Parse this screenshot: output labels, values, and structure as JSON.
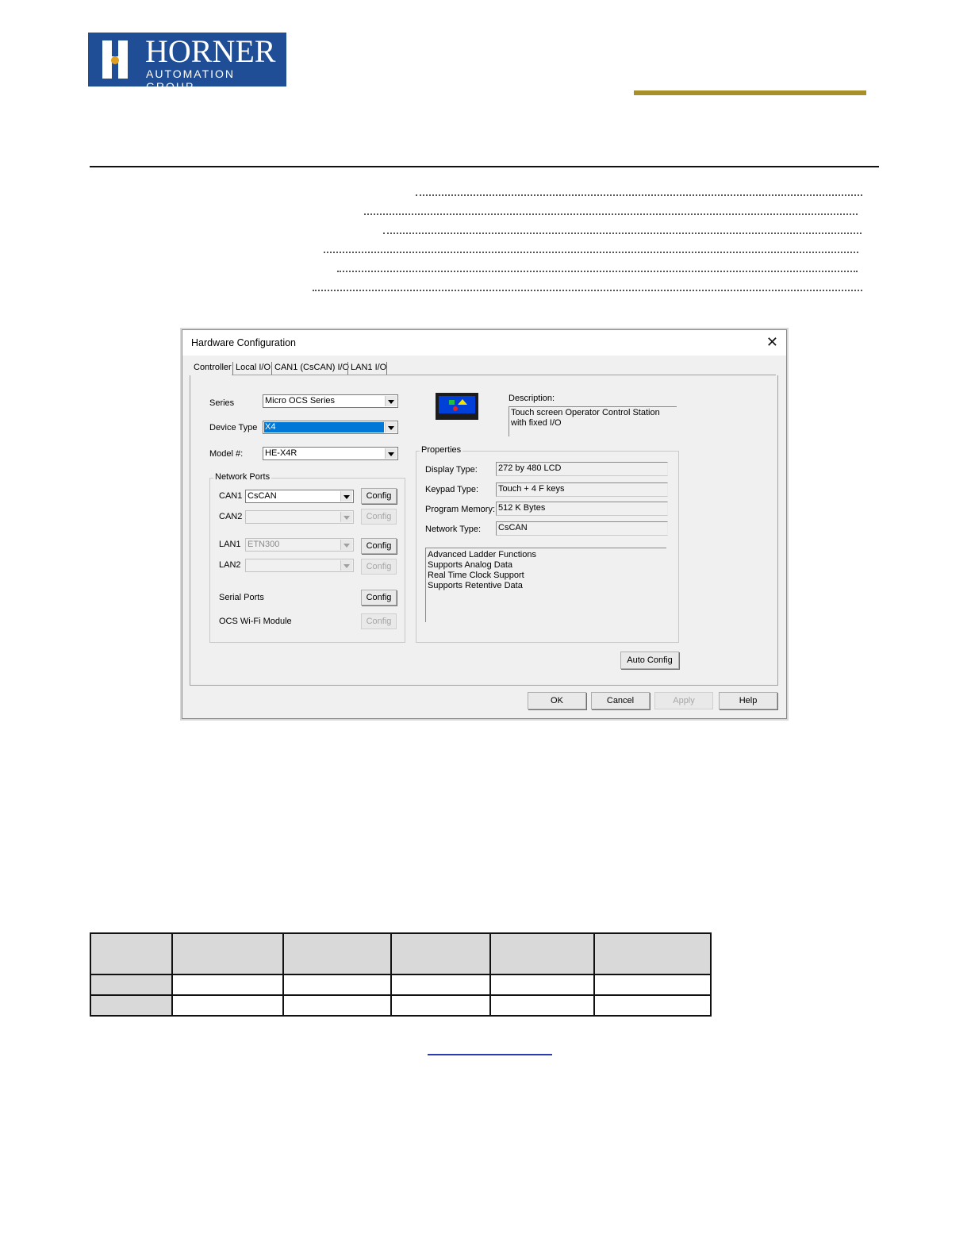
{
  "logo": {
    "name": "HORNER",
    "tagline": "AUTOMATION GROUP"
  },
  "dialog": {
    "title": "Hardware Configuration",
    "tabs": [
      "Controller",
      "Local I/O",
      "CAN1 (CsCAN) I/O",
      "LAN1 I/O"
    ],
    "series_label": "Series",
    "series_value": "Micro OCS Series",
    "device_type_label": "Device Type",
    "device_type_value": "X4",
    "model_label": "Model #:",
    "model_value": "HE-X4R",
    "network_ports_title": "Network Ports",
    "ports": [
      {
        "label": "CAN1",
        "value": "CsCAN",
        "enabled": true,
        "config": "Config"
      },
      {
        "label": "CAN2",
        "value": "",
        "enabled": false,
        "config": "Config"
      },
      {
        "label": "LAN1",
        "value": "ETN300",
        "enabled": false,
        "config": "Config"
      },
      {
        "label": "LAN2",
        "value": "",
        "enabled": false,
        "config": "Config"
      }
    ],
    "serial_ports_label": "Serial Ports",
    "serial_config": "Config",
    "wifi_label": "OCS Wi-Fi Module",
    "wifi_config": "Config",
    "description_label": "Description:",
    "description_text": "Touch screen Operator Control Station with fixed I/O",
    "properties_title": "Properties",
    "properties": [
      {
        "label": "Display Type:",
        "value": "272 by 480 LCD"
      },
      {
        "label": "Keypad Type:",
        "value": "Touch + 4 F keys"
      },
      {
        "label": "Program Memory:",
        "value": "512 K Bytes"
      },
      {
        "label": "Network Type:",
        "value": "CsCAN"
      }
    ],
    "features": [
      "Advanced Ladder Functions",
      "Supports Analog Data",
      "Real Time Clock Support",
      "Supports Retentive Data"
    ],
    "auto_config": "Auto Config",
    "buttons": {
      "ok": "OK",
      "cancel": "Cancel",
      "apply": "Apply",
      "help": "Help"
    }
  },
  "colors": {
    "brand_blue": "#1f4e96",
    "gold_accent": "#a88f2a",
    "selection": "#0078d7"
  }
}
